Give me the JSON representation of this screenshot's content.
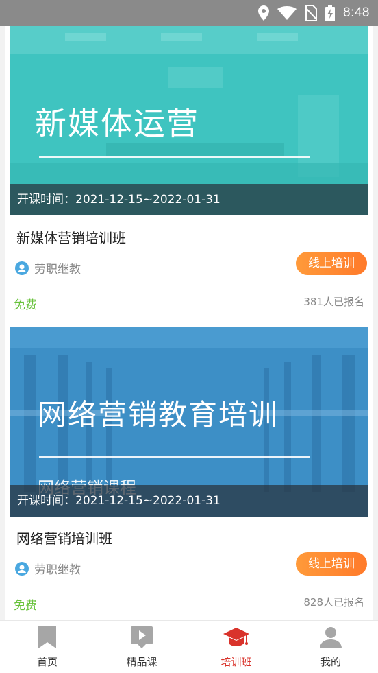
{
  "status_bar": {
    "time": "8:48"
  },
  "courses": [
    {
      "banner_title": "新媒体运营",
      "banner_subtitle": "",
      "date_text": "开课时间：2021-12-15~2022-01-31",
      "title": "新媒体营销培训班",
      "org": "劳职继教",
      "tag": "线上培训",
      "price": "免费",
      "signups": "381人已报名",
      "banner_color": "#3fc4c0"
    },
    {
      "banner_title": "网络营销教育培训",
      "banner_subtitle": "网络营销课程",
      "date_text": "开课时间：2021-12-15~2022-01-31",
      "title": "网络营销培训班",
      "org": "劳职继教",
      "tag": "线上培训",
      "price": "免费",
      "signups": "828人已报名",
      "banner_color": "#3d8fc6"
    }
  ],
  "bottom_nav": [
    {
      "label": "首页",
      "icon": "bookmark-icon",
      "active": false
    },
    {
      "label": "精品课",
      "icon": "video-play-icon",
      "active": false
    },
    {
      "label": "培训班",
      "icon": "graduation-cap-icon",
      "active": true
    },
    {
      "label": "我的",
      "icon": "user-icon",
      "active": false
    }
  ],
  "colors": {
    "accent": "#d9332b",
    "tag_orange": "#ff8a33",
    "free_green": "#67c23a"
  }
}
